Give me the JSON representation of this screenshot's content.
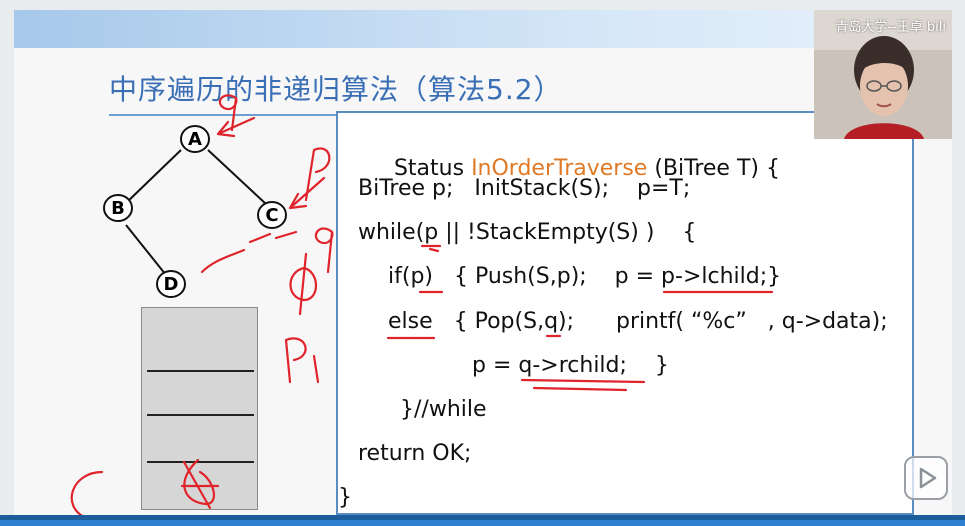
{
  "slide": {
    "title": "中序遍历的非递归算法（算法5.2）"
  },
  "tree": {
    "nodes": [
      "A",
      "B",
      "C",
      "D"
    ]
  },
  "code": {
    "line1_pre": "Status ",
    "line1_fn": "InOrderTraverse",
    "line1_post": " (BiTree T) {",
    "line2": "BiTree p;   InitStack(S);    p=T;",
    "line3": "while(p || !StackEmpty(S) )    {",
    "line4": "if(p)   { Push(S,p);    p = p->lchild;}",
    "line5": "else   { Pop(S,q);      printf( “%c”   , q->data);",
    "line6": "p = q->rchild;    }",
    "line7": "}//while",
    "line8": "return OK;",
    "line9": "}"
  },
  "webcam": {
    "label": "青岛大学--王卓 bili"
  },
  "icons": {
    "play": "play-icon"
  },
  "colors": {
    "title": "#3a6fb5",
    "function": "#e07a27",
    "annotation": "#e0242c",
    "border": "#5b8dc4"
  }
}
